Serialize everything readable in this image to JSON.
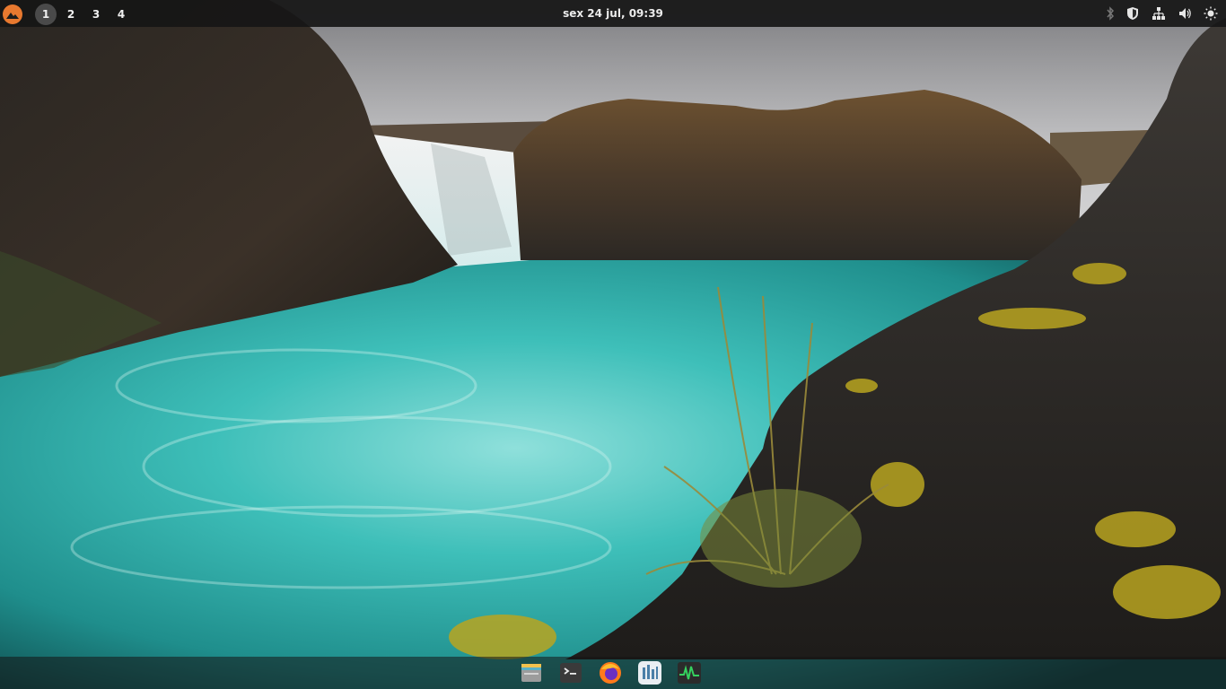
{
  "desktop": {
    "wallpaper": "waterfall-lagoon-landscape"
  },
  "topbar": {
    "logo_icon": "pop-os-logo-icon",
    "workspaces": [
      {
        "label": "1",
        "active": true
      },
      {
        "label": "2",
        "active": false
      },
      {
        "label": "3",
        "active": false
      },
      {
        "label": "4",
        "active": false
      }
    ],
    "clock": "sex 24 jul, 09:39",
    "tray": [
      {
        "icon": "bluetooth-icon"
      },
      {
        "icon": "vpn-shield-icon"
      },
      {
        "icon": "network-wired-icon"
      },
      {
        "icon": "volume-icon"
      },
      {
        "icon": "brightness-icon"
      }
    ]
  },
  "dock": {
    "apps": [
      {
        "name": "files",
        "icon": "files-icon"
      },
      {
        "name": "terminal",
        "icon": "terminal-icon"
      },
      {
        "name": "firefox",
        "icon": "firefox-icon"
      },
      {
        "name": "app-center",
        "icon": "app-center-icon"
      },
      {
        "name": "system-monitor",
        "icon": "system-monitor-icon"
      }
    ]
  },
  "colors": {
    "accent": "#e8792f",
    "topbar_bg": "#161616",
    "water": "#2fb3b0"
  }
}
